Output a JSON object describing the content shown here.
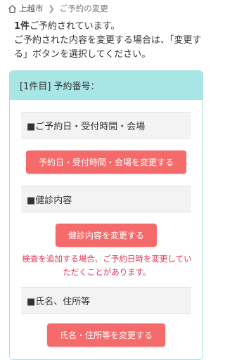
{
  "breadcrumb": {
    "home": "上越市",
    "current": "ご予約の変更"
  },
  "intro": {
    "count": "1件",
    "line1_rest": "ご予約されています。",
    "line2": "ご予約された内容を変更する場合は、「変更する」ボタンを選択してください。"
  },
  "card": {
    "header": "[1件目] 予約番号：",
    "sections": [
      {
        "label": "■ご予約日・受付時間・会場",
        "button": "予約日・受付時間・会場を変更する"
      },
      {
        "label": "■健診内容",
        "button": "健診内容を変更する",
        "note": "検査を追加する場合、ご予約日時を変更していただくことがあります。"
      },
      {
        "label": "■氏名、住所等",
        "button": "氏名・住所等を変更する"
      }
    ]
  },
  "colors": {
    "accent_header": "#a7e6e4",
    "button": "#f56a6a",
    "note": "#e53358"
  }
}
